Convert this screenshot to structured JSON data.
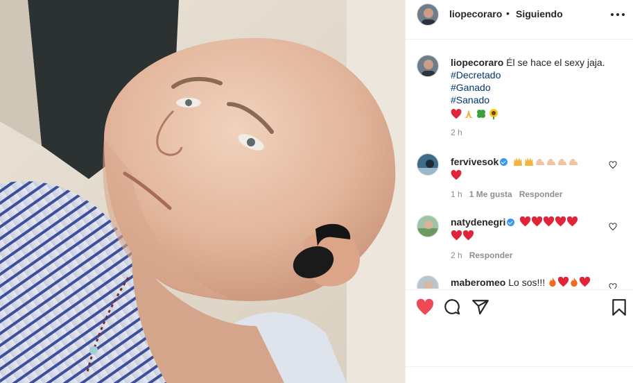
{
  "post": {
    "username": "liopecoraro",
    "follow_state": "Siguiendo",
    "separator": "•"
  },
  "caption": {
    "username": "liopecoraro",
    "text": "Él se hace el sexy jaja.",
    "hashtags": [
      "#Decretado",
      "#Ganado",
      "#Sanado"
    ],
    "emojis": [
      "heart",
      "folded-hands",
      "four-leaf-clover",
      "sunflower"
    ],
    "time": "2 h"
  },
  "comments": [
    {
      "username": "fervivesok",
      "verified": true,
      "emojis": [
        "raising-hands",
        "raising-hands",
        "flexed-biceps",
        "flexed-biceps",
        "flexed-biceps",
        "flexed-biceps",
        "heart"
      ],
      "time": "1 h",
      "likes": "1 Me gusta",
      "reply": "Responder"
    },
    {
      "username": "natydenegri",
      "verified": true,
      "emojis": [
        "heart",
        "heart",
        "heart",
        "heart",
        "heart",
        "heart",
        "heart"
      ],
      "time": "2 h",
      "reply": "Responder"
    },
    {
      "username": "maberomeo",
      "verified": false,
      "text": "Lo sos!!!",
      "emojis": [
        "fire",
        "heart",
        "fire",
        "heart"
      ]
    }
  ],
  "colors": {
    "link": "#00376b",
    "like_active": "#ed4956",
    "verified": "#3897f0",
    "muted": "#8e8e8e"
  },
  "icons": [
    "more-options-icon",
    "heart-icon",
    "comment-icon",
    "share-icon",
    "bookmark-icon"
  ]
}
